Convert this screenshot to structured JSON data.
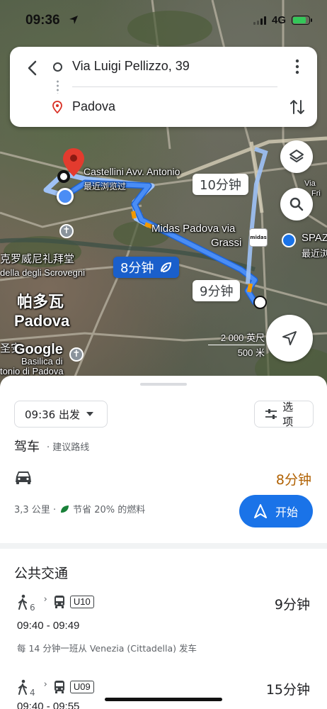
{
  "status_bar": {
    "time": "09:36",
    "network": "4G"
  },
  "route": {
    "from": "Via Luigi Pellizzo, 39",
    "to": "Padova"
  },
  "map": {
    "places": {
      "castellini": "Castellini Avv. Antonio",
      "castellini_sub": "最近浏览过",
      "midas_1": "Midas Padova via",
      "midas_2": "Grassi",
      "midas_logo": "midas",
      "spaz": "SPAZ",
      "spaz_sub": "最近浏",
      "cappella": "克罗威尼礼拜堂",
      "cappella_it": "della degli Scrovegni",
      "city_cn": "帕多瓦",
      "city_it": "Padova",
      "basilica_1": "圣安",
      "basilica_2": "Basilica di",
      "basilica_3": "tonio di Padova",
      "via": "Via",
      "fri": "Fri"
    },
    "google_logo": "Google",
    "time_bubbles": {
      "alt1": "10分钟",
      "selected": "8分钟",
      "alt2": "9分钟"
    },
    "scale": {
      "imperial": "2 000 英尺",
      "metric": "500 米"
    },
    "route_color": "#4a8df5"
  },
  "sheet": {
    "depart_chip": "09:36 出发",
    "options_chip": "选项",
    "drive": {
      "title": "驾车",
      "subtitle": "· 建议路线",
      "duration": "8分钟",
      "distance": "3,3 公里 ·",
      "fuel": "节省 20% 的燃料",
      "start": "开始"
    },
    "transit": {
      "title": "公共交通",
      "routes": [
        {
          "walk_minutes": "6",
          "bus": "U10",
          "duration": "9分钟",
          "hours": "09:40 - 09:49",
          "frequency": "每 14 分钟一班从 Venezia (Cittadella) 发车"
        },
        {
          "walk_minutes": "4",
          "bus": "U09",
          "duration": "15分钟",
          "hours": "09:40 - 09:55",
          "frequency": ""
        }
      ]
    }
  },
  "colors": {
    "accent": "#1a73e8",
    "drive_time": "#b06000",
    "selected_bubble": "#1a5fcb"
  }
}
